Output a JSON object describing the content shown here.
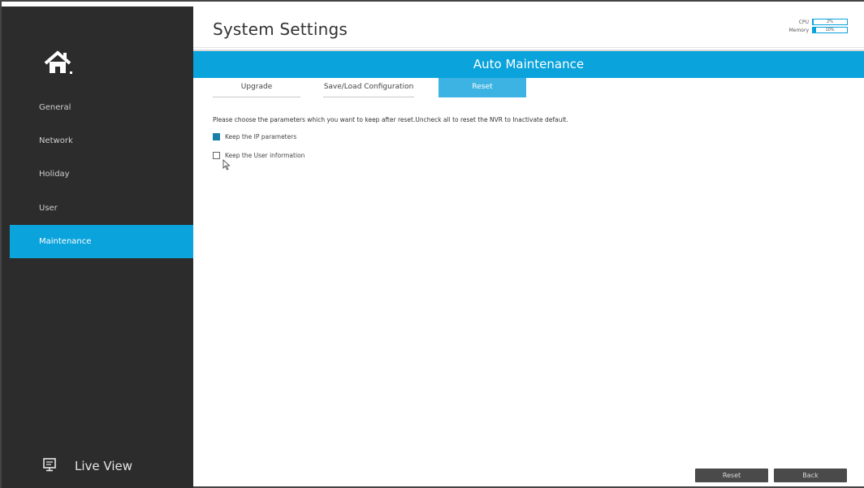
{
  "header": {
    "title": "System Settings",
    "cpu_label": "CPU",
    "cpu_value": "2%",
    "cpu_percent": 2,
    "memory_label": "Memory",
    "memory_value": "10%",
    "memory_percent": 10
  },
  "sidebar": {
    "home_icon": "home-icon",
    "items": [
      {
        "label": "General"
      },
      {
        "label": "Network"
      },
      {
        "label": "Holiday"
      },
      {
        "label": "User"
      },
      {
        "label": "Maintenance",
        "active": true
      }
    ],
    "live_view": {
      "label": "Live View",
      "icon": "monitor-icon"
    }
  },
  "band": {
    "title": "Auto Maintenance"
  },
  "tabs": [
    {
      "label": "Upgrade"
    },
    {
      "label": "Save/Load Configuration"
    },
    {
      "label": "Reset",
      "active": true
    }
  ],
  "content": {
    "description": "Please choose the parameters which you want to keep after reset.Uncheck all to reset the NVR to Inactivate default.",
    "options": [
      {
        "label": "Keep the IP parameters",
        "checked": true
      },
      {
        "label": "Keep the User information",
        "checked": false
      }
    ]
  },
  "buttons": {
    "reset": "Reset",
    "back": "Back"
  },
  "colors": {
    "accent": "#0aa3dc",
    "sidebar_bg": "#2c2c2c",
    "button_bg": "#4a4a4a",
    "checkbox_checked": "#1a7fa6"
  }
}
